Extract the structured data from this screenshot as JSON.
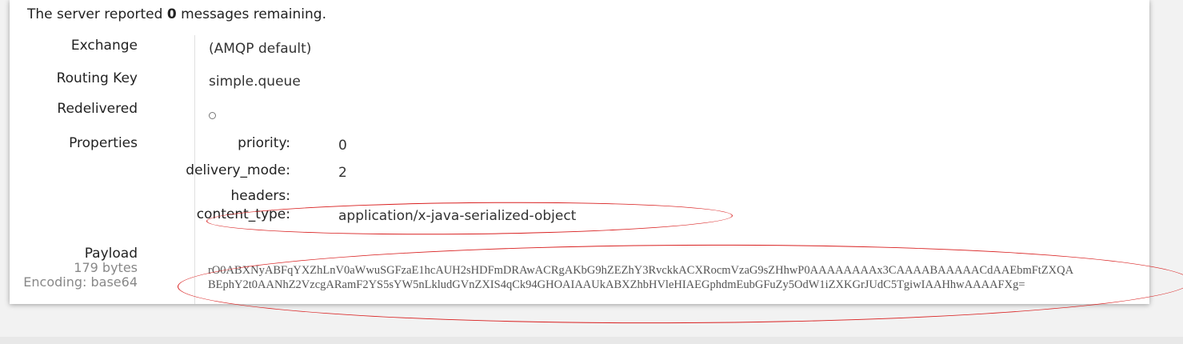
{
  "status": {
    "prefix": "The server reported ",
    "count": "0",
    "suffix": " messages remaining."
  },
  "message": {
    "exchange": {
      "label": "Exchange",
      "value": "(AMQP default)"
    },
    "routing_key": {
      "label": "Routing Key",
      "value": "simple.queue"
    },
    "redelivered": {
      "label": "Redelivered",
      "value_icon": "circle-icon"
    },
    "properties": {
      "label": "Properties",
      "priority": {
        "key": "priority:",
        "value": "0"
      },
      "delivery_mode": {
        "key": "delivery_mode:",
        "value": "2"
      },
      "headers": {
        "key": "headers:",
        "value": ""
      },
      "content_type": {
        "key": "content_type:",
        "value": "application/x-java-serialized-object"
      }
    },
    "payload": {
      "label": "Payload",
      "size": "179 bytes",
      "encoding": "Encoding: base64",
      "line1": "rO0ABXNyABFqYXZhLnV0aWwuSGFzaE1hcAUH2sHDFmDRAwACRgAKbG9hZEZhY3RvckkACXRocmVzaG9sZHhwP0AAAAAAAAx3CAAAABAAAAACdAAEbmFtZXQA",
      "line2": "BEphY2t0AANhZ2VzcgARamF2YS5sYW5nLkludGVnZXIS4qCk94GHOAIAAUkABXZhbHVleHIAEGphdmEubGFuZy5OdW1iZXKGrJUdC5TgiwIAAHhwAAAAFXg="
    }
  },
  "annotation_color": "#d92020"
}
